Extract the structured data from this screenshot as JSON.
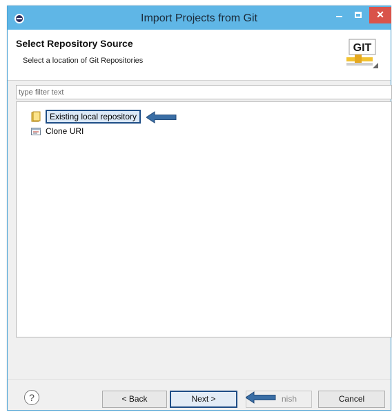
{
  "window": {
    "title": "Import Projects from Git",
    "controls": {
      "minimize": "–",
      "maximize": "□",
      "close": "✕"
    }
  },
  "header": {
    "title": "Select Repository Source",
    "description": "Select a location of Git Repositories",
    "logo_text": "GIT"
  },
  "filter": {
    "placeholder": "type filter text",
    "value": ""
  },
  "tree": {
    "items": [
      {
        "label": "Existing local repository",
        "icon": "repository-folder-icon",
        "selected": true
      },
      {
        "label": "Clone URI",
        "icon": "clone-uri-icon",
        "selected": false
      }
    ]
  },
  "buttons": {
    "help": "?",
    "back": "< Back",
    "next": "Next >",
    "finish": "nish",
    "cancel": "Cancel"
  },
  "colors": {
    "titlebar": "#5fb6e6",
    "close": "#d9534a",
    "annotation_arrow": "#3a6ea5",
    "selection_border": "#1e4d86"
  }
}
